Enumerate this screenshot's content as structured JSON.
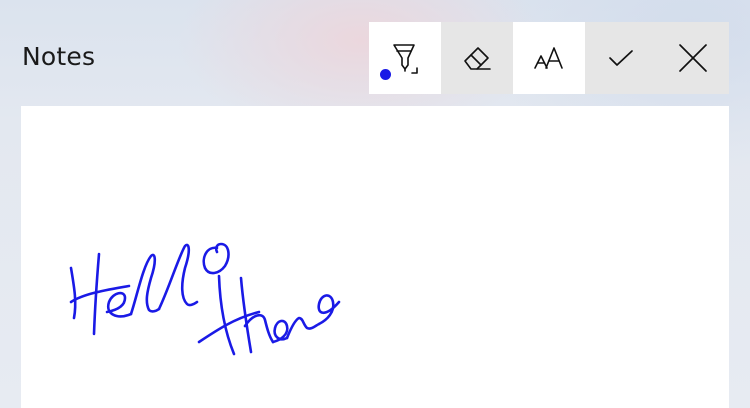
{
  "app": {
    "title": "Notes"
  },
  "toolbar": {
    "tools": [
      {
        "name": "pen",
        "icon": "ballpoint-pen-icon",
        "pen_color": "#1a1ae6"
      },
      {
        "name": "eraser",
        "icon": "eraser-icon"
      },
      {
        "name": "convert-to-text",
        "icon": "text-aa-icon"
      },
      {
        "name": "accept",
        "icon": "checkmark-icon"
      },
      {
        "name": "cancel",
        "icon": "close-icon"
      }
    ]
  },
  "canvas": {
    "ink_color": "#1a1ae6",
    "handwriting": [
      "Hello",
      "there"
    ]
  }
}
